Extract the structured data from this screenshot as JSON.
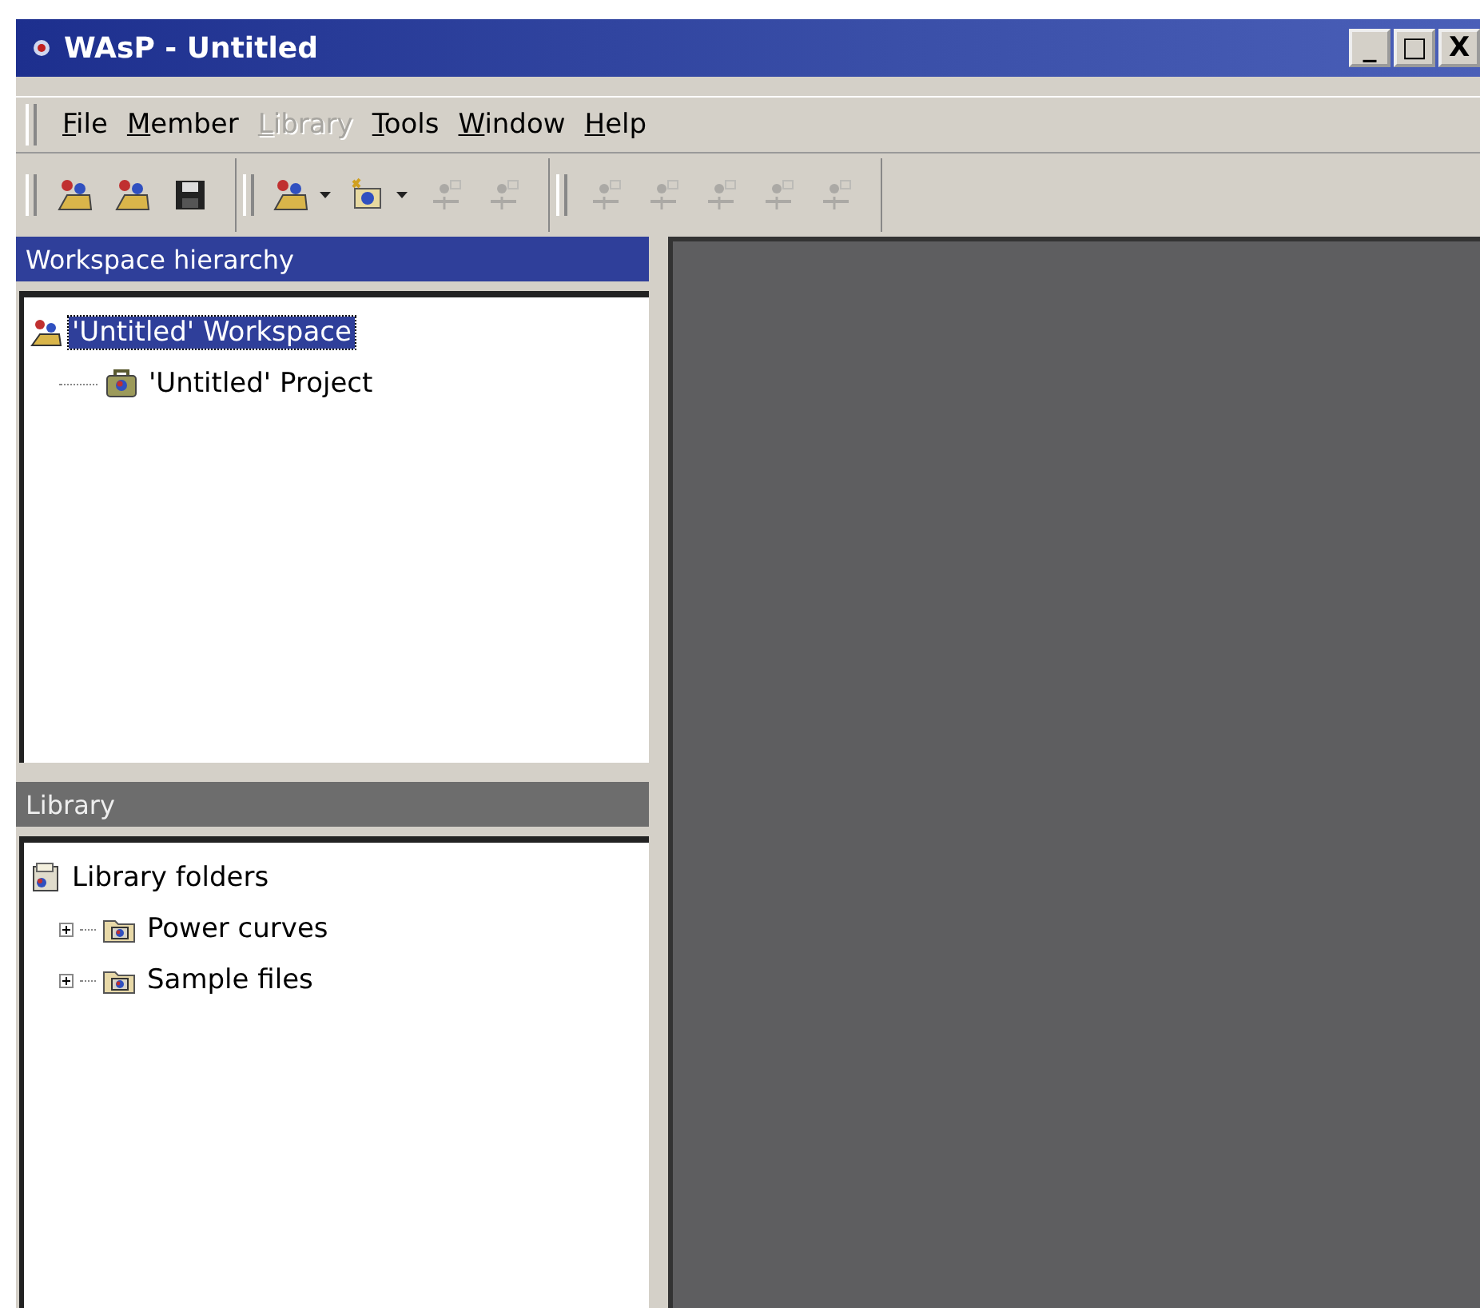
{
  "window": {
    "title": "WAsP - Untitled"
  },
  "title_buttons": [
    "_",
    "□",
    "X"
  ],
  "menu": [
    {
      "label": "File",
      "disabled": false
    },
    {
      "label": "Member",
      "disabled": false
    },
    {
      "label": "Library",
      "disabled": true
    },
    {
      "label": "Tools",
      "disabled": false
    },
    {
      "label": "Window",
      "disabled": false
    },
    {
      "label": "Help",
      "disabled": false
    }
  ],
  "toolbar_groups": [
    [
      {
        "disabled": false,
        "dropdown": false
      },
      {
        "disabled": false,
        "dropdown": false
      },
      {
        "disabled": false,
        "dropdown": false
      }
    ],
    [
      {
        "disabled": false,
        "dropdown": true
      },
      {
        "disabled": false,
        "dropdown": true
      },
      {
        "disabled": true,
        "dropdown": false
      },
      {
        "disabled": true,
        "dropdown": false
      }
    ],
    [
      {
        "disabled": true,
        "dropdown": false
      },
      {
        "disabled": true,
        "dropdown": false
      },
      {
        "disabled": true,
        "dropdown": false
      },
      {
        "disabled": true,
        "dropdown": false
      },
      {
        "disabled": true,
        "dropdown": false
      }
    ]
  ],
  "workspace_panel": {
    "title": "Workspace hierarchy",
    "active": true,
    "tree": [
      {
        "label": "'Untitled' Workspace",
        "kind": "workspace",
        "selected": true,
        "children": [
          {
            "label": "'Untitled' Project",
            "kind": "project",
            "selected": false
          }
        ]
      }
    ]
  },
  "library_panel": {
    "title": "Library",
    "active": false,
    "tree": [
      {
        "label": "Library folders",
        "kind": "library",
        "selected": false,
        "children": [
          {
            "label": "Power curves",
            "kind": "folder",
            "selected": false,
            "expanded": false
          },
          {
            "label": "Sample files",
            "kind": "folder",
            "selected": false,
            "expanded": false
          }
        ]
      }
    ]
  }
}
